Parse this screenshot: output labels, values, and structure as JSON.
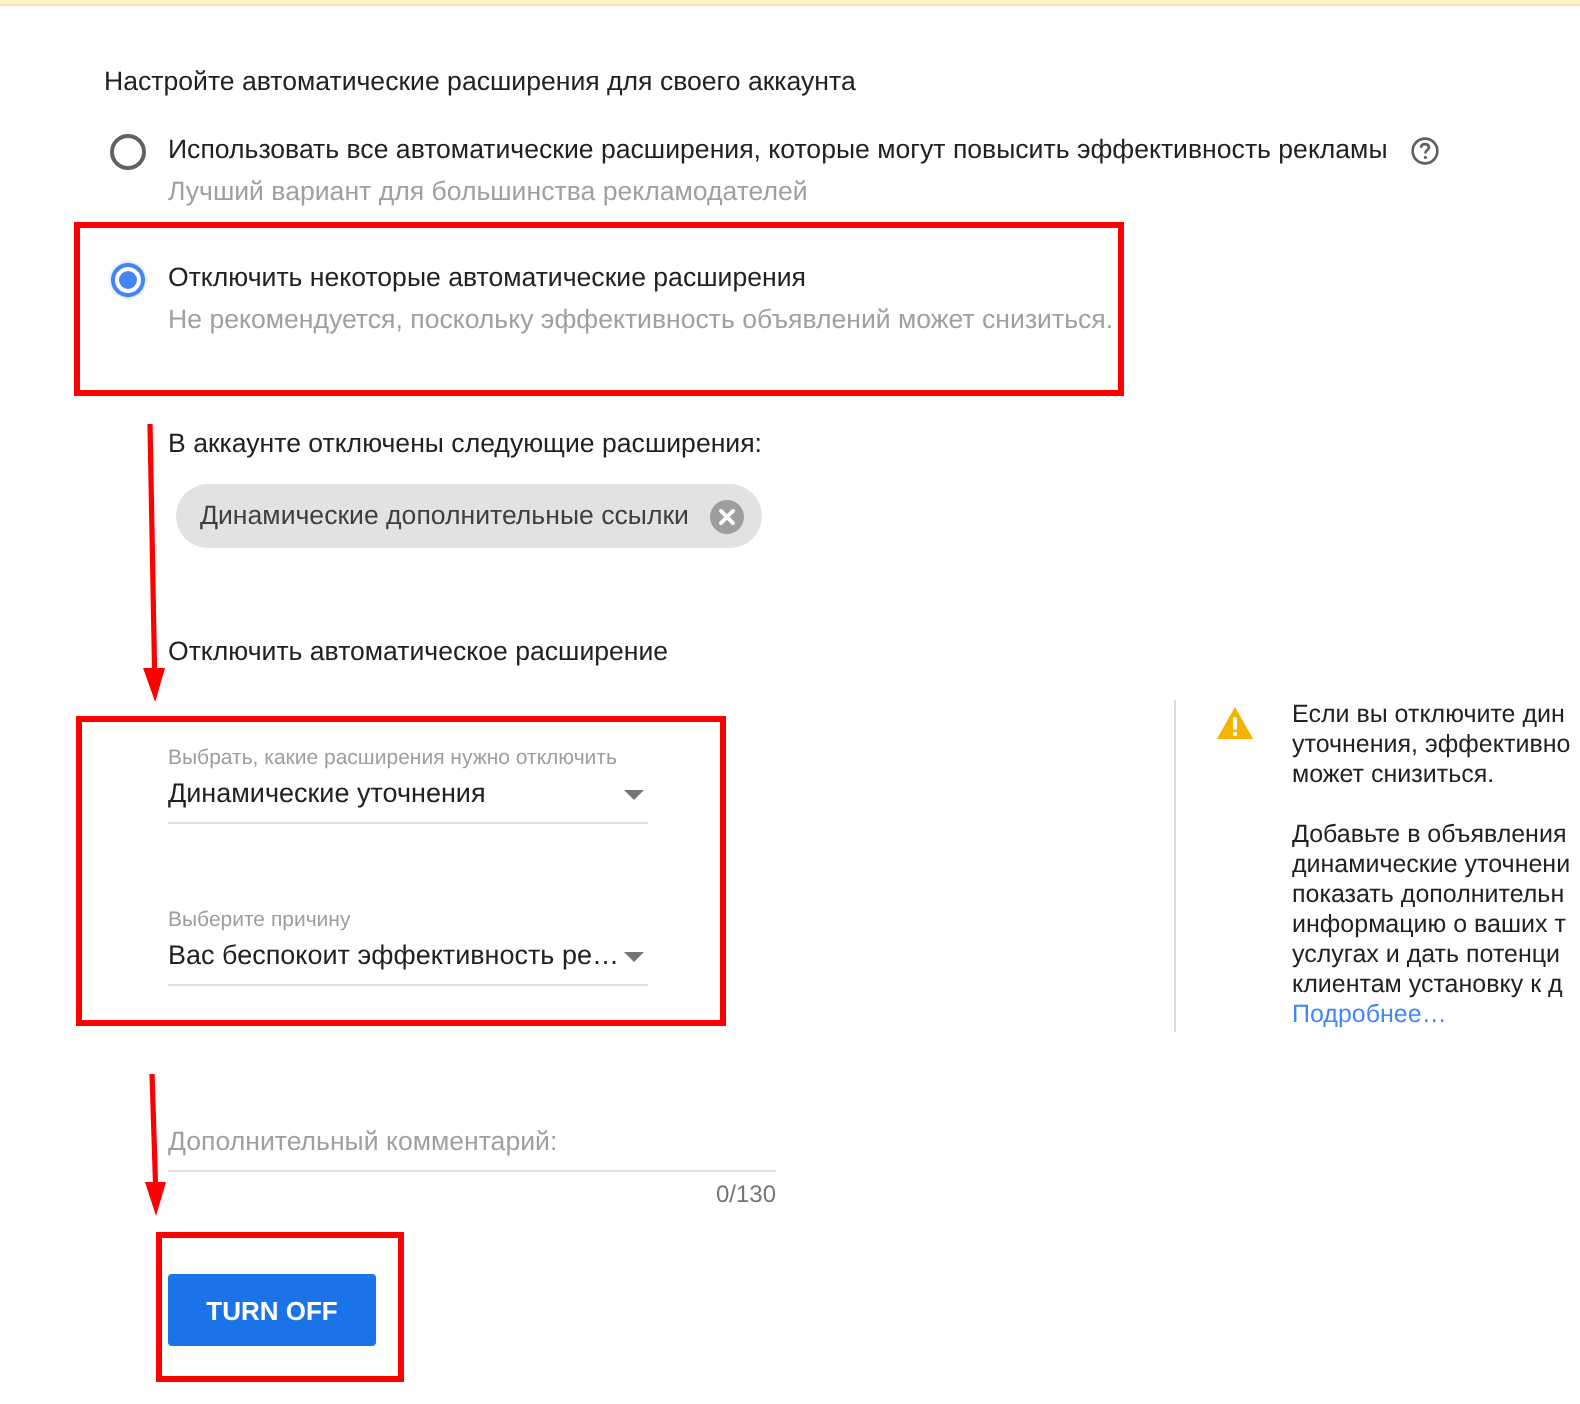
{
  "settings": {
    "title": "Настройте автоматические расширения для своего аккаунта",
    "options": [
      {
        "label": "Использовать все автоматические расширения, которые могут повысить эффективность рекламы",
        "description": "Лучший вариант для большинства рекламодателей",
        "selected": false,
        "help": true,
        "highlighted": false
      },
      {
        "label": "Отключить некоторые автоматические расширения",
        "description": "Не рекомендуется, поскольку эффективность объявлений может снизиться.",
        "selected": true,
        "help": false,
        "highlighted": true
      }
    ]
  },
  "disabled_extensions": {
    "label": "В аккаунте отключены следующие расширения:",
    "chips": [
      {
        "label": "Динамические дополнительные ссылки"
      }
    ]
  },
  "turn_off": {
    "title": "Отключить автоматическое расширение",
    "highlighted": true,
    "fields": [
      {
        "label": "Выбрать, какие расширения нужно отключить",
        "value": "Динамические уточнения"
      },
      {
        "label": "Выберите причину",
        "value": "Вас беспокоит эффективность ре…"
      }
    ],
    "comment": {
      "placeholder": "Дополнительный комментарий:",
      "counter": "0/130"
    },
    "button": {
      "label": "TURN OFF",
      "highlighted": true
    }
  },
  "warning": {
    "paragraphs": [
      [
        "Если вы отключите дин",
        "уточнения, эффективно",
        "может снизиться."
      ],
      [
        "Добавьте в объявления",
        "динамические уточнени",
        "показать дополнительн",
        "информацию о ваших т",
        "услугах и дать потенци",
        "клиентам установку к д"
      ]
    ],
    "link": "Подробнее…"
  }
}
